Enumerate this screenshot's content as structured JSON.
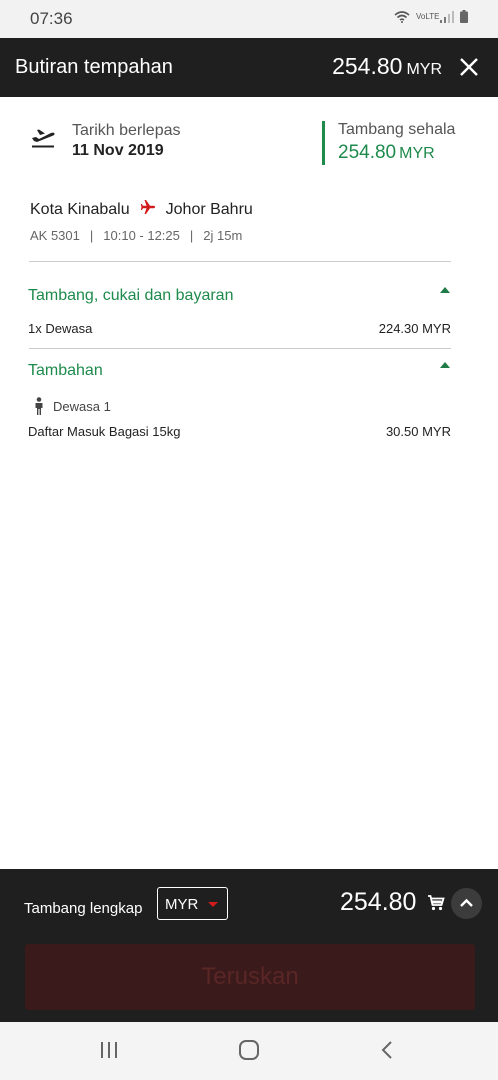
{
  "status": {
    "time": "07:36",
    "icons": [
      "wifi-icon",
      "volte-icon",
      "signal-icon",
      "battery-icon"
    ],
    "volte_text": "VoLTE"
  },
  "header": {
    "title": "Butiran tempahan",
    "amount": "254.80",
    "currency": "MYR"
  },
  "flight": {
    "depart_label": "Tarikh berlepas",
    "depart_date": "11 Nov 2019",
    "fare_label": "Tambang sehala",
    "fare_amount": "254.80",
    "fare_currency": "MYR",
    "origin": "Kota Kinabalu",
    "destination": "Johor Bahru",
    "flight_no": "AK 5301",
    "time": "10:10 - 12:25",
    "duration": "2j 15m"
  },
  "sections": {
    "fares_title": "Tambang, cukai dan bayaran",
    "adult_line": "1x Dewasa",
    "adult_price": "224.30 MYR",
    "extras_title": "Tambahan",
    "passenger": "Dewasa 1",
    "baggage_line": "Daftar Masuk Bagasi 15kg",
    "baggage_price": "30.50 MYR"
  },
  "footer": {
    "total_label": "Tambang lengkap",
    "currency_select": "MYR",
    "total": "254.80",
    "continue_label": "Teruskan"
  },
  "colors": {
    "accent_green": "#1e8a4c",
    "dark_bar": "#1f1f1f",
    "airasia_red": "#d01c1c",
    "disabled_button": "#3a1a1a"
  }
}
